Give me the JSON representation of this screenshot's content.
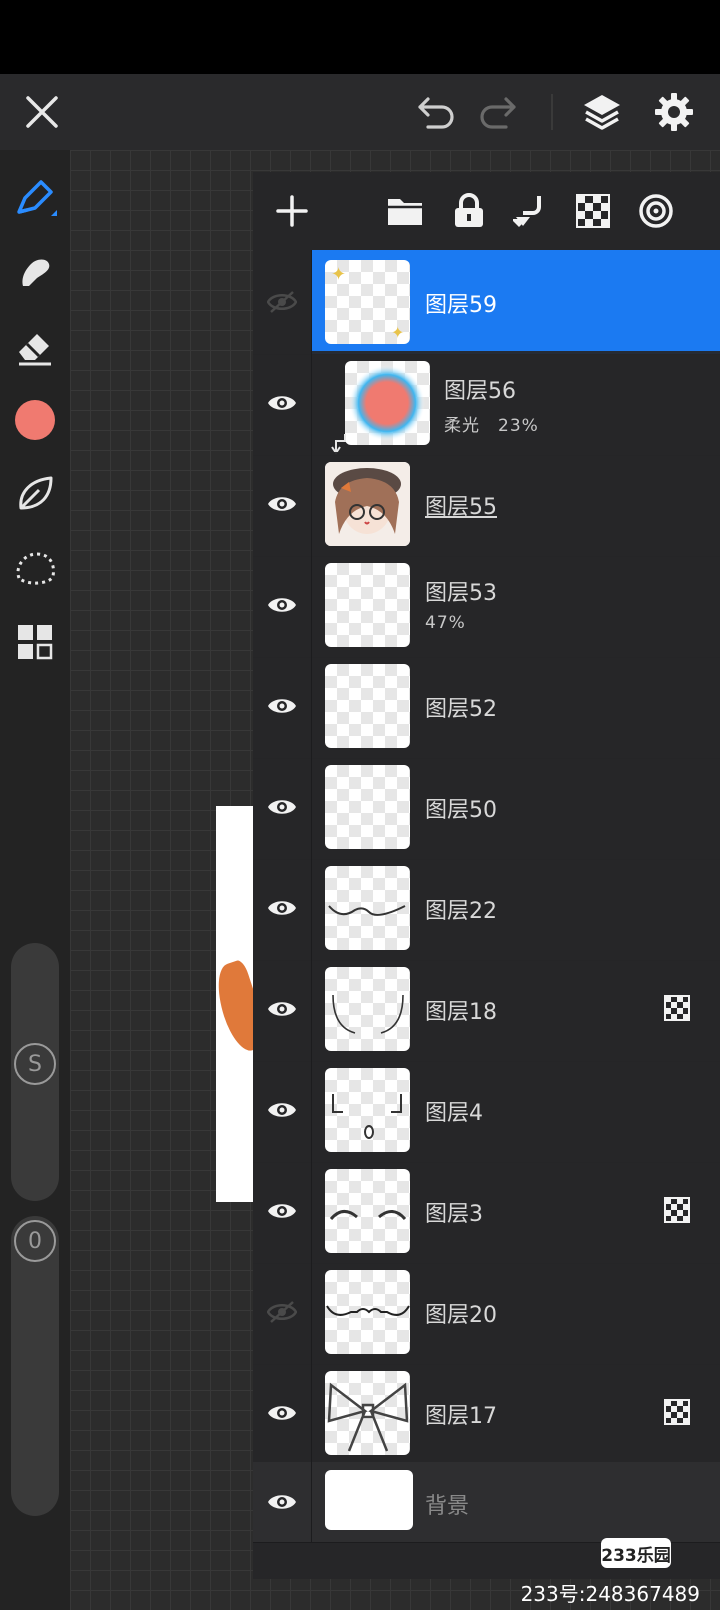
{
  "toolbar_top": {
    "close_icon": "close-icon",
    "undo_icon": "undo-icon",
    "redo_icon": "redo-icon",
    "layers_icon": "layers-icon",
    "settings_icon": "gear-icon"
  },
  "colors": {
    "accent": "#1b7af2",
    "current_color": "#f07a70",
    "panel": "#262628",
    "hair": "#e0793a"
  },
  "sliders": {
    "size_label": "S",
    "opacity_label": "0"
  },
  "layers": [
    {
      "name": "图层59",
      "selected": true,
      "visible": false
    },
    {
      "name": "图层56",
      "sub": "柔光　23%",
      "visible": true,
      "clipped": true
    },
    {
      "name": "图层55",
      "visible": true,
      "underline": true
    },
    {
      "name": "图层53",
      "sub": "47%",
      "visible": true
    },
    {
      "name": "图层52",
      "visible": true
    },
    {
      "name": "图层50",
      "visible": true
    },
    {
      "name": "图层22",
      "visible": true
    },
    {
      "name": "图层18",
      "visible": true,
      "alpha_lock": true
    },
    {
      "name": "图层4",
      "visible": true
    },
    {
      "name": "图层3",
      "visible": true,
      "alpha_lock": true
    },
    {
      "name": "图层20",
      "visible": false
    },
    {
      "name": "图层17",
      "visible": true,
      "alpha_lock": true
    },
    {
      "name": "背景",
      "visible": true
    }
  ],
  "watermark": {
    "logo": "233乐园",
    "text": "233号:248367489"
  }
}
